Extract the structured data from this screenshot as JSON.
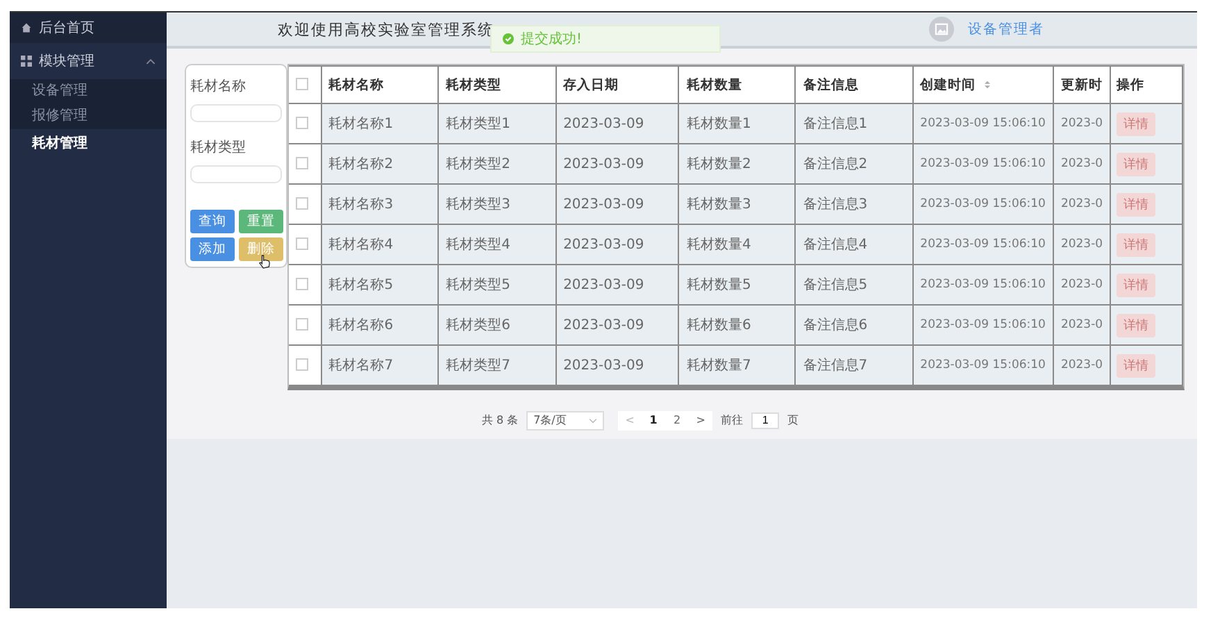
{
  "sidebar": {
    "home": {
      "label": "后台首页"
    },
    "group": {
      "label": "模块管理",
      "expanded": true,
      "children": [
        {
          "label": "设备管理",
          "selected": false
        },
        {
          "label": "报修管理",
          "selected": false
        },
        {
          "label": "耗材管理",
          "selected": true
        }
      ]
    }
  },
  "header": {
    "title": "欢迎使用高校实验室管理系统",
    "toast": {
      "kind": "success",
      "message": "提交成功!"
    },
    "user": {
      "name": "设备管理者"
    }
  },
  "filters": [
    {
      "label": "耗材名称"
    },
    {
      "label": "耗材类型"
    }
  ],
  "buttons": [
    {
      "label": "查询",
      "color": "#4a90e2"
    },
    {
      "label": "重置",
      "color": "#5cb87a"
    },
    {
      "label": "添加",
      "color": "#4a90e2"
    },
    {
      "label": "删除",
      "color": "#dfbe6a"
    }
  ],
  "table": {
    "header_checked": false,
    "columns": [
      {
        "label": "耗材名称",
        "sortable": false
      },
      {
        "label": "耗材类型",
        "sortable": false
      },
      {
        "label": "存入日期",
        "sortable": false
      },
      {
        "label": "耗材数量",
        "sortable": false
      },
      {
        "label": "备注信息",
        "sortable": false
      },
      {
        "label": "创建时间",
        "sortable": true
      },
      {
        "label": "更新时",
        "sortable": false
      },
      {
        "label": "操作",
        "sortable": false
      }
    ],
    "rows": [
      {
        "checked": false,
        "cells": [
          "耗材名称1",
          "耗材类型1",
          "2023-03-09",
          "耗材数量1",
          "备注信息1",
          "2023-03-09 15:06:10",
          "2023-0"
        ],
        "action": "详情"
      },
      {
        "checked": false,
        "cells": [
          "耗材名称2",
          "耗材类型2",
          "2023-03-09",
          "耗材数量2",
          "备注信息2",
          "2023-03-09 15:06:10",
          "2023-0"
        ],
        "action": "详情"
      },
      {
        "checked": false,
        "cells": [
          "耗材名称3",
          "耗材类型3",
          "2023-03-09",
          "耗材数量3",
          "备注信息3",
          "2023-03-09 15:06:10",
          "2023-0"
        ],
        "action": "详情"
      },
      {
        "checked": false,
        "cells": [
          "耗材名称4",
          "耗材类型4",
          "2023-03-09",
          "耗材数量4",
          "备注信息4",
          "2023-03-09 15:06:10",
          "2023-0"
        ],
        "action": "详情"
      },
      {
        "checked": false,
        "cells": [
          "耗材名称5",
          "耗材类型5",
          "2023-03-09",
          "耗材数量5",
          "备注信息5",
          "2023-03-09 15:06:10",
          "2023-0"
        ],
        "action": "详情"
      },
      {
        "checked": false,
        "cells": [
          "耗材名称6",
          "耗材类型6",
          "2023-03-09",
          "耗材数量6",
          "备注信息6",
          "2023-03-09 15:06:10",
          "2023-0"
        ],
        "action": "详情"
      },
      {
        "checked": false,
        "cells": [
          "耗材名称7",
          "耗材类型7",
          "2023-03-09",
          "耗材数量7",
          "备注信息7",
          "2023-03-09 15:06:10",
          "2023-0"
        ],
        "action": "详情"
      }
    ]
  },
  "pagination": {
    "total": "共 8 条",
    "page_size": "7条/页",
    "prev": "<",
    "pages": [
      {
        "label": "1",
        "selected": true
      },
      {
        "label": "2",
        "selected": false
      }
    ],
    "next": ">",
    "goto_label": "前往",
    "goto_value": "1",
    "page_suffix": "页"
  }
}
